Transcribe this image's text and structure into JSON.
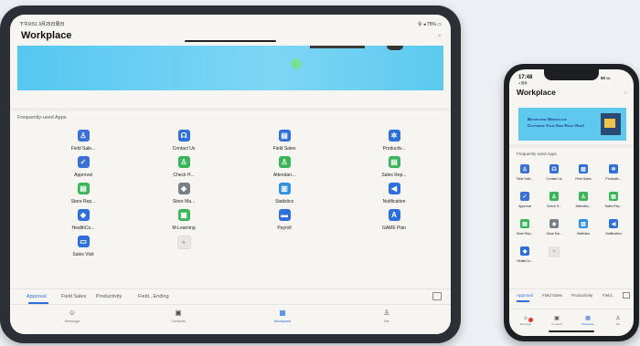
{
  "tablet": {
    "status_left": "下午9:51  3月25日周日",
    "status_right": "令 ◂ 75% ▭",
    "title": "Workplace",
    "section_label": "Frequently-used Apps",
    "apps": [
      {
        "label": "Field Sale...",
        "icon": "person-outline-icon",
        "color": "#3c6fd8"
      },
      {
        "label": "Contact Us",
        "icon": "headset-icon",
        "color": "#2f6fdc"
      },
      {
        "label": "Field Sales",
        "icon": "id-card-icon",
        "color": "#2f6fdc"
      },
      {
        "label": "Productiv...",
        "icon": "gear-icon",
        "color": "#2f6fdc"
      },
      {
        "label": "Approval",
        "icon": "approval-check-icon",
        "color": "#3c6fd8"
      },
      {
        "label": "Check H...",
        "icon": "person-pin-icon",
        "color": "#3bb55a"
      },
      {
        "label": "Attendan...",
        "icon": "person-pin-icon",
        "color": "#3bb55a"
      },
      {
        "label": "Sales Rep...",
        "icon": "document-icon",
        "color": "#3bb55a"
      },
      {
        "label": "Store Rep...",
        "icon": "document-icon",
        "color": "#3bb55a"
      },
      {
        "label": "Store Ma...",
        "icon": "store-chart-icon",
        "color": "#7a7f87"
      },
      {
        "label": "Statistics",
        "icon": "bar-chart-icon",
        "color": "#2f8fe0"
      },
      {
        "label": "Notification",
        "icon": "speaker-icon",
        "color": "#2f6fdc"
      },
      {
        "label": "HealthCo...",
        "icon": "shield-icon",
        "color": "#2f6fdc"
      },
      {
        "label": "M-Learning",
        "icon": "learning-icon",
        "color": "#3bb55a"
      },
      {
        "label": "Payroll",
        "icon": "wallet-icon",
        "color": "#2f6fdc"
      },
      {
        "label": "GAME Plan",
        "icon": "game-plan-icon",
        "color": "#2f6fdc"
      },
      {
        "label": "Sales Visit",
        "icon": "store-icon",
        "color": "#2f6fdc"
      },
      {
        "label": "",
        "icon": "add-icon",
        "color": "#e8e6e3"
      }
    ],
    "tabs": [
      "Approval",
      "Field Sales",
      "Productivity",
      "Field...Ending"
    ],
    "nav": [
      {
        "label": "Message",
        "icon": "chat-icon"
      },
      {
        "label": "Contacts",
        "icon": "contacts-icon"
      },
      {
        "label": "Workplace",
        "icon": "grid-icon"
      },
      {
        "label": "Me",
        "icon": "person-icon"
      }
    ]
  },
  "phone": {
    "time": "17:48",
    "back": "◂ 搜索",
    "status_right": "50 ▭",
    "title": "Workplace",
    "banner_line1": "Brand-new Workplace",
    "banner_line2": "Customize Your Own Right Now!",
    "section_label": "Frequently-used Apps",
    "apps": [
      {
        "label": "Field Sale...",
        "color": "#3c6fd8"
      },
      {
        "label": "Contact Us",
        "color": "#2f6fdc"
      },
      {
        "label": "Field Sales",
        "color": "#2f6fdc"
      },
      {
        "label": "Productiv...",
        "color": "#2f6fdc"
      },
      {
        "label": "Approval",
        "color": "#3c6fd8"
      },
      {
        "label": "Check H...",
        "color": "#3bb55a"
      },
      {
        "label": "Attendan...",
        "color": "#3bb55a"
      },
      {
        "label": "Sales Rep...",
        "color": "#3bb55a"
      },
      {
        "label": "Store Rep...",
        "color": "#3bb55a"
      },
      {
        "label": "Store Ma...",
        "color": "#7a7f87"
      },
      {
        "label": "Statistics",
        "color": "#2f8fe0"
      },
      {
        "label": "Notification",
        "color": "#2f6fdc"
      },
      {
        "label": "HealthCo...",
        "color": "#2f6fdc"
      },
      {
        "label": "",
        "color": "#e8e6e3"
      }
    ],
    "tabs": [
      "Approval",
      "Field Sales",
      "Productivity",
      "Field..."
    ],
    "nav": [
      "Message",
      "Contacts",
      "Workplace",
      "Me"
    ]
  }
}
